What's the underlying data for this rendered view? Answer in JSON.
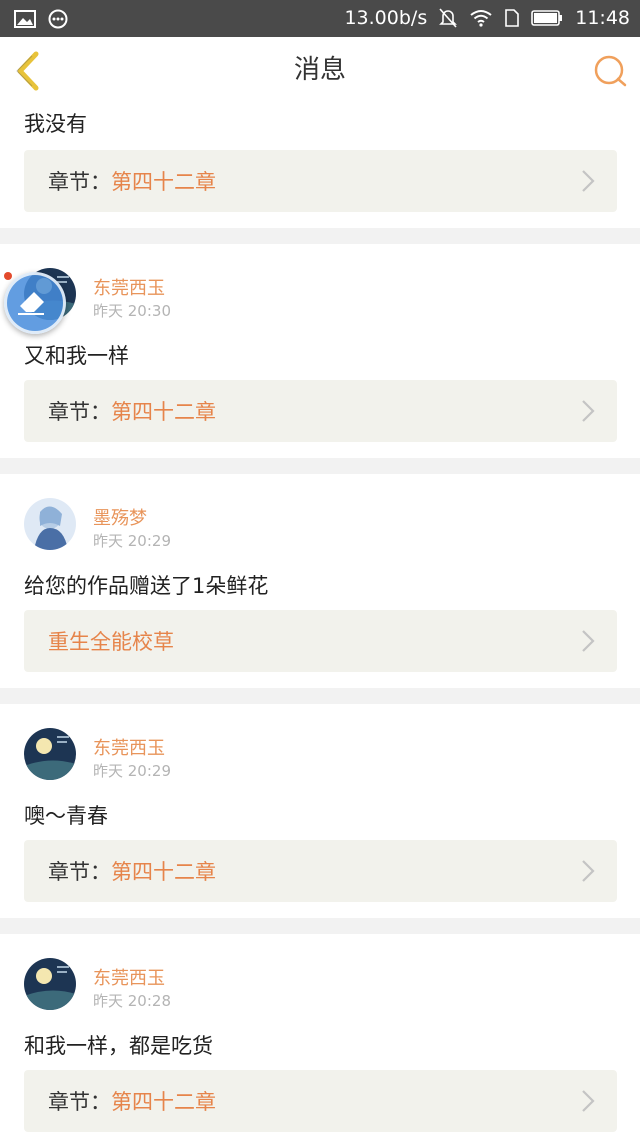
{
  "statusbar": {
    "speed": "13.00b/s",
    "time": "11:48"
  },
  "header": {
    "title": "消息"
  },
  "items": [
    {
      "comment": "我没有",
      "ref_prefix": "章节：",
      "ref_title": "第四十二章"
    },
    {
      "user": "东莞西玉",
      "time": "昨天 20:30",
      "comment": "又和我一样",
      "ref_prefix": "章节：",
      "ref_title": "第四十二章"
    },
    {
      "user": "墨殇梦",
      "time": "昨天 20:29",
      "comment": "给您的作品赠送了1朵鲜花",
      "ref_prefix": "",
      "ref_title": "重生全能校草"
    },
    {
      "user": "东莞西玉",
      "time": "昨天 20:29",
      "comment": "噢～青春",
      "ref_prefix": "章节：",
      "ref_title": "第四十二章"
    },
    {
      "user": "东莞西玉",
      "time": "昨天 20:28",
      "comment": "和我一样，都是吃货",
      "ref_prefix": "章节：",
      "ref_title": "第四十二章"
    }
  ],
  "colors": {
    "accent": "#e6844a",
    "back_icon": "#e8c33a",
    "statusbar": "#4a4a4a"
  },
  "icons": [
    "image-icon",
    "more-icon",
    "mute-icon",
    "wifi-icon",
    "sim-icon",
    "battery-icon",
    "back-arrow-icon",
    "search-icon",
    "chevron-right-icon"
  ]
}
